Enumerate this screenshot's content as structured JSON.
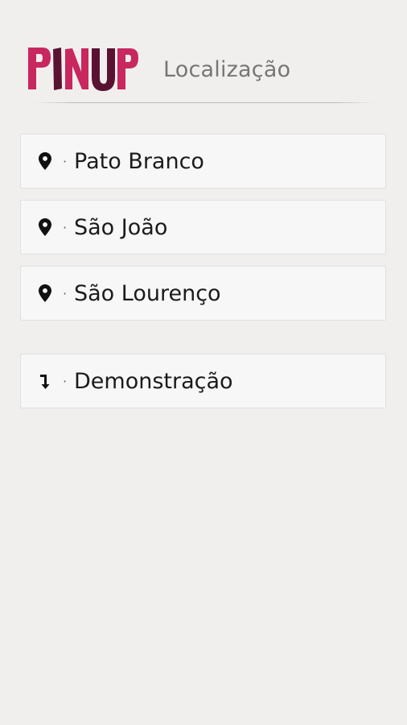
{
  "header": {
    "brand": "PINUP",
    "title": "Localização"
  },
  "locations": [
    {
      "label": "Pato Branco",
      "icon": "map-pin-icon"
    },
    {
      "label": "São João",
      "icon": "map-pin-icon"
    },
    {
      "label": "São Lourenço",
      "icon": "map-pin-icon"
    }
  ],
  "demo": {
    "label": "Demonstração",
    "icon": "arrow-down-icon"
  },
  "separator": "·",
  "colors": {
    "background": "#f0efed",
    "card": "#f7f7f7",
    "brand_pink": "#c8275f",
    "brand_dark": "#5a1233",
    "title_gray": "#767676"
  }
}
